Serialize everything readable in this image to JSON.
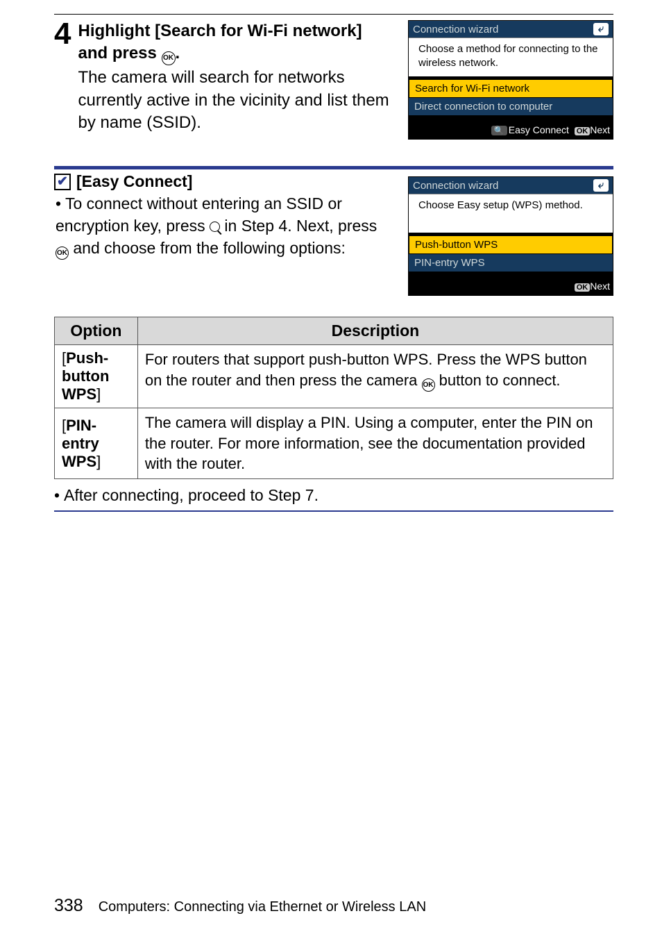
{
  "step": {
    "number": "4",
    "title_part1": "Highlight [Search for Wi-Fi network] and press ",
    "title_part2": ".",
    "desc": "The camera will search for networks currently active in the vicinity and list them by name (SSID)."
  },
  "screenshot1": {
    "title": "Connection wizard",
    "msg": "Choose a method for connecting to the wireless network.",
    "row_selected": "Search for Wi-Fi network",
    "row_other": "Direct connection to computer",
    "footer_easy": "Easy Connect",
    "footer_next": "Next"
  },
  "callout": {
    "heading": "[Easy Connect]",
    "body_line1": "To connect without entering an SSID or encryption key, press ",
    "body_line2": " in Step 4. Next, press ",
    "body_line3": " and choose from the following options:"
  },
  "screenshot2": {
    "title": "Connection wizard",
    "msg": "Choose Easy setup (WPS) method.",
    "row_selected": "Push-button WPS",
    "row_other": "PIN-entry WPS",
    "footer_next": "Next"
  },
  "table": {
    "head_option": "Option",
    "head_desc": "Description",
    "opt1_a": "Push-button",
    "opt1_b": "WPS",
    "opt1_brL": "[",
    "opt1_brR": "]",
    "desc1": "For routers that support push-button WPS. Press the WPS button on the router and then press the camera ",
    "desc1b": " button to connect.",
    "opt2_a": "PIN-entry",
    "opt2_b": "WPS",
    "desc2": "The camera will display a PIN. Using a computer, enter the PIN on the router. For more information, see the documentation provided with the router."
  },
  "after": "After connecting, proceed to Step 7.",
  "footer": {
    "page": "338",
    "section": "Computers: Connecting via Ethernet or Wireless LAN"
  }
}
